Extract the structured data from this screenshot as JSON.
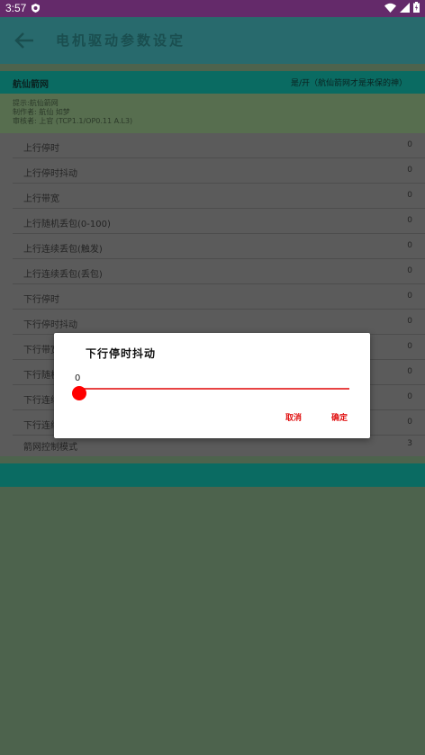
{
  "status": {
    "time": "3:57"
  },
  "appbar": {
    "title": "电机驱动参数设定"
  },
  "header": {
    "left": "航仙箭网",
    "right": "是/开（航仙箭网才是来保的神）"
  },
  "info": [
    "提示:航仙箭网",
    "制作者: 航仙  如梦",
    "审核者: 上官   (TCP1.1/OP0.11 A.L3)"
  ],
  "rows": [
    {
      "label": "上行停时",
      "value": "0"
    },
    {
      "label": "上行停时抖动",
      "value": "0"
    },
    {
      "label": "上行带宽",
      "value": "0"
    },
    {
      "label": "上行随机丢包(0-100)",
      "value": "0"
    },
    {
      "label": "上行连续丢包(触发)",
      "value": "0"
    },
    {
      "label": "上行连续丢包(丢包)",
      "value": "0"
    },
    {
      "label": "下行停时",
      "value": "0"
    },
    {
      "label": "下行停时抖动",
      "value": "0"
    },
    {
      "label": "下行带宽",
      "value": "0"
    },
    {
      "label": "下行随机丢包(0-100)",
      "value": "0"
    },
    {
      "label": "下行连续丢包(触发)",
      "value": "0"
    },
    {
      "label": "下行连续丢包(丢包)",
      "value": "0"
    },
    {
      "label": "箭网控制模式",
      "value": "3"
    }
  ],
  "dialog": {
    "title": "下行停时抖动",
    "value": "0",
    "slider_fraction": 0,
    "cancel": "取消",
    "ok": "确定"
  },
  "colors": {
    "accent": "#0a6b62",
    "status": "#642a6a",
    "slider": "#e84343"
  }
}
